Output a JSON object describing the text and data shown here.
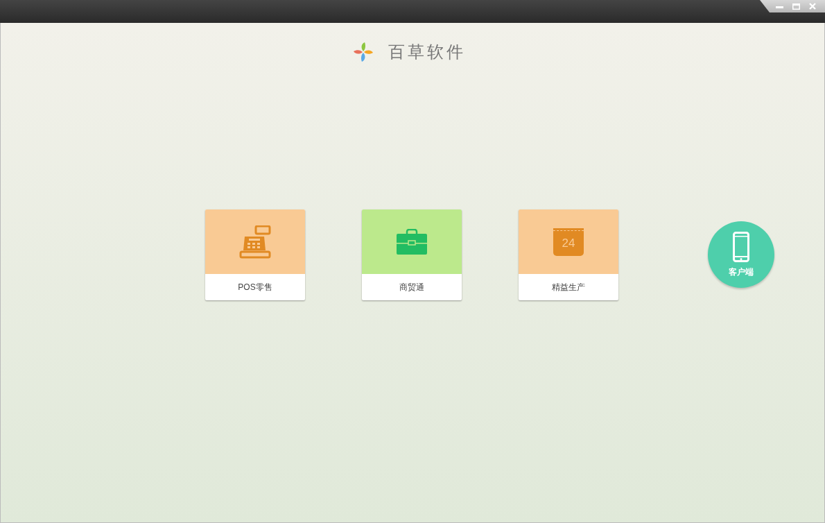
{
  "window_controls": [
    {
      "kind": "minimize"
    },
    {
      "kind": "maximize"
    },
    {
      "kind": "close"
    }
  ],
  "brand": {
    "name": "百草软件"
  },
  "tiles": [
    {
      "kind": "register",
      "label": "POS零售",
      "color": "#f9ca94"
    },
    {
      "kind": "briefcase",
      "label": "商贸通",
      "color": "#bce98c"
    },
    {
      "kind": "calendar",
      "label": "精益生产",
      "color": "#f9ca94",
      "icon_text": "24"
    }
  ],
  "client_button": {
    "label": "客户端"
  }
}
